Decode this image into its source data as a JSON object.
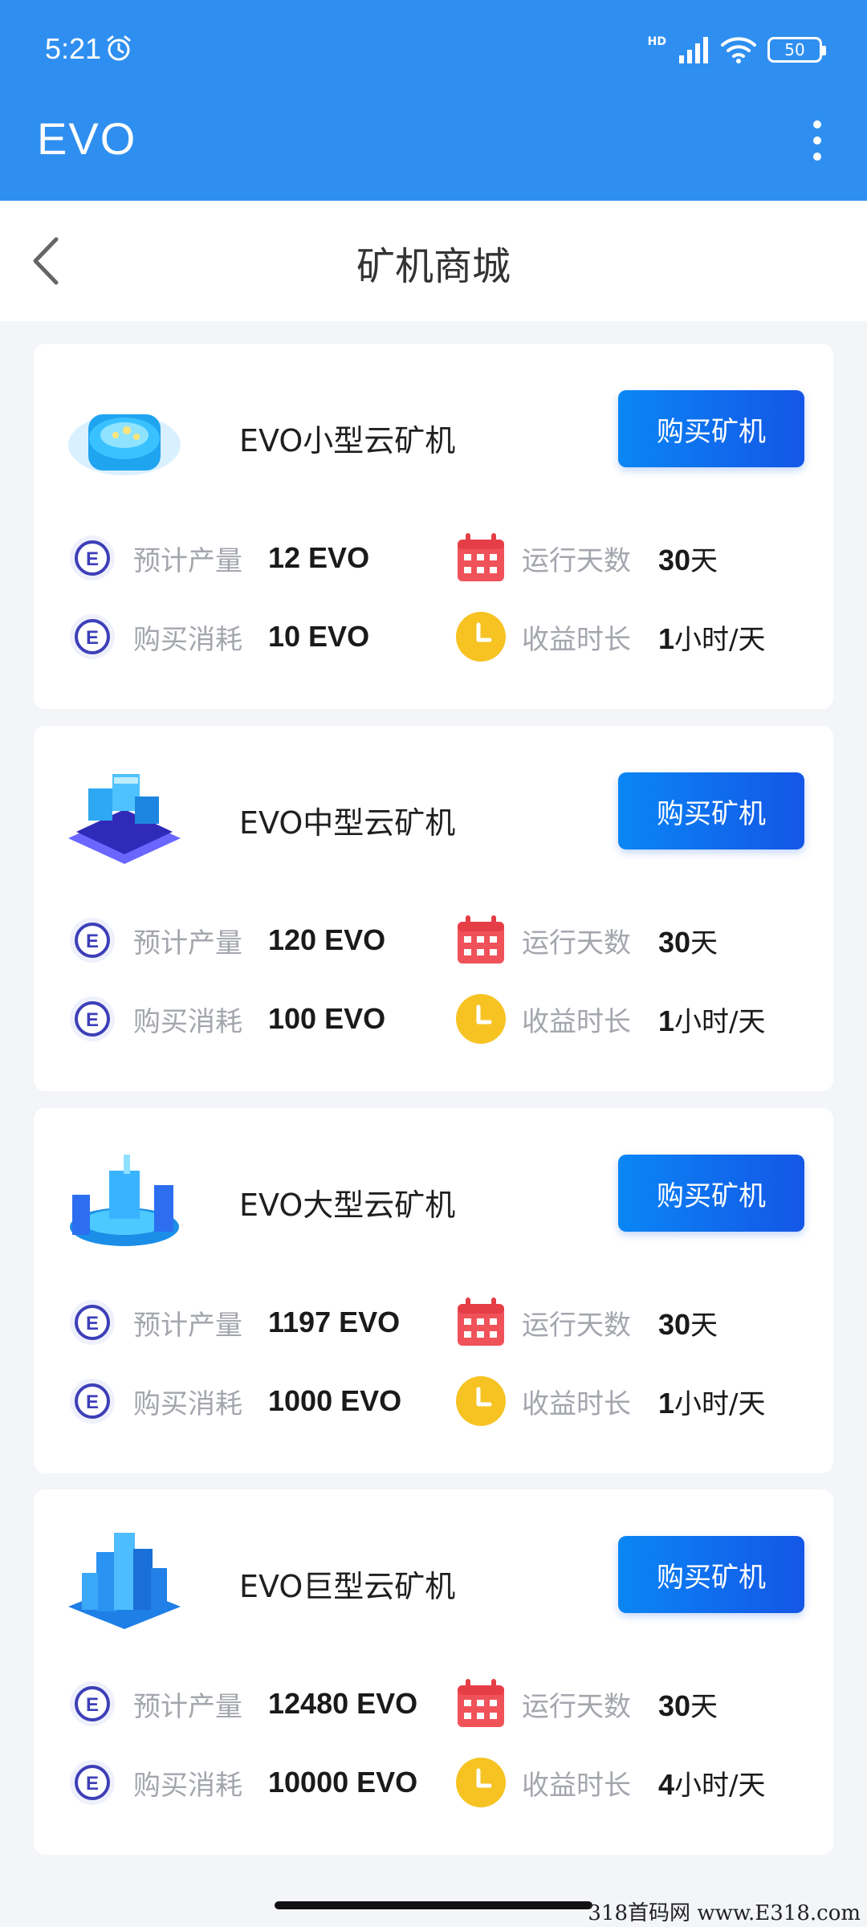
{
  "status_bar": {
    "time": "5:21",
    "network": "HD",
    "battery": "50"
  },
  "app_bar": {
    "title": "EVO"
  },
  "nav": {
    "title": "矿机商城"
  },
  "labels": {
    "expected_output": "预计产量",
    "purchase_cost": "购买消耗",
    "run_days": "运行天数",
    "earning_duration": "收益时长",
    "buy_button": "购买矿机"
  },
  "cards": [
    {
      "name": "EVO小型云矿机",
      "expected_output": "12 EVO",
      "purchase_cost": "10 EVO",
      "run_days_num": "30",
      "run_days_unit": "天",
      "duration_num": "1",
      "duration_unit": "小时/天"
    },
    {
      "name": "EVO中型云矿机",
      "expected_output": "120 EVO",
      "purchase_cost": "100 EVO",
      "run_days_num": "30",
      "run_days_unit": "天",
      "duration_num": "1",
      "duration_unit": "小时/天"
    },
    {
      "name": "EVO大型云矿机",
      "expected_output": "1197 EVO",
      "purchase_cost": "1000 EVO",
      "run_days_num": "30",
      "run_days_unit": "天",
      "duration_num": "1",
      "duration_unit": "小时/天"
    },
    {
      "name": "EVO巨型云矿机",
      "expected_output": "12480 EVO",
      "purchase_cost": "10000 EVO",
      "run_days_num": "30",
      "run_days_unit": "天",
      "duration_num": "4",
      "duration_unit": "小时/天"
    }
  ],
  "watermark": "318首码网 www.E318.com",
  "colors": {
    "primary": "#2f8ff0",
    "button_start": "#0a86f5",
    "button_end": "#1456e6",
    "calendar_red": "#f0525a",
    "clock_yellow": "#f6c323"
  }
}
